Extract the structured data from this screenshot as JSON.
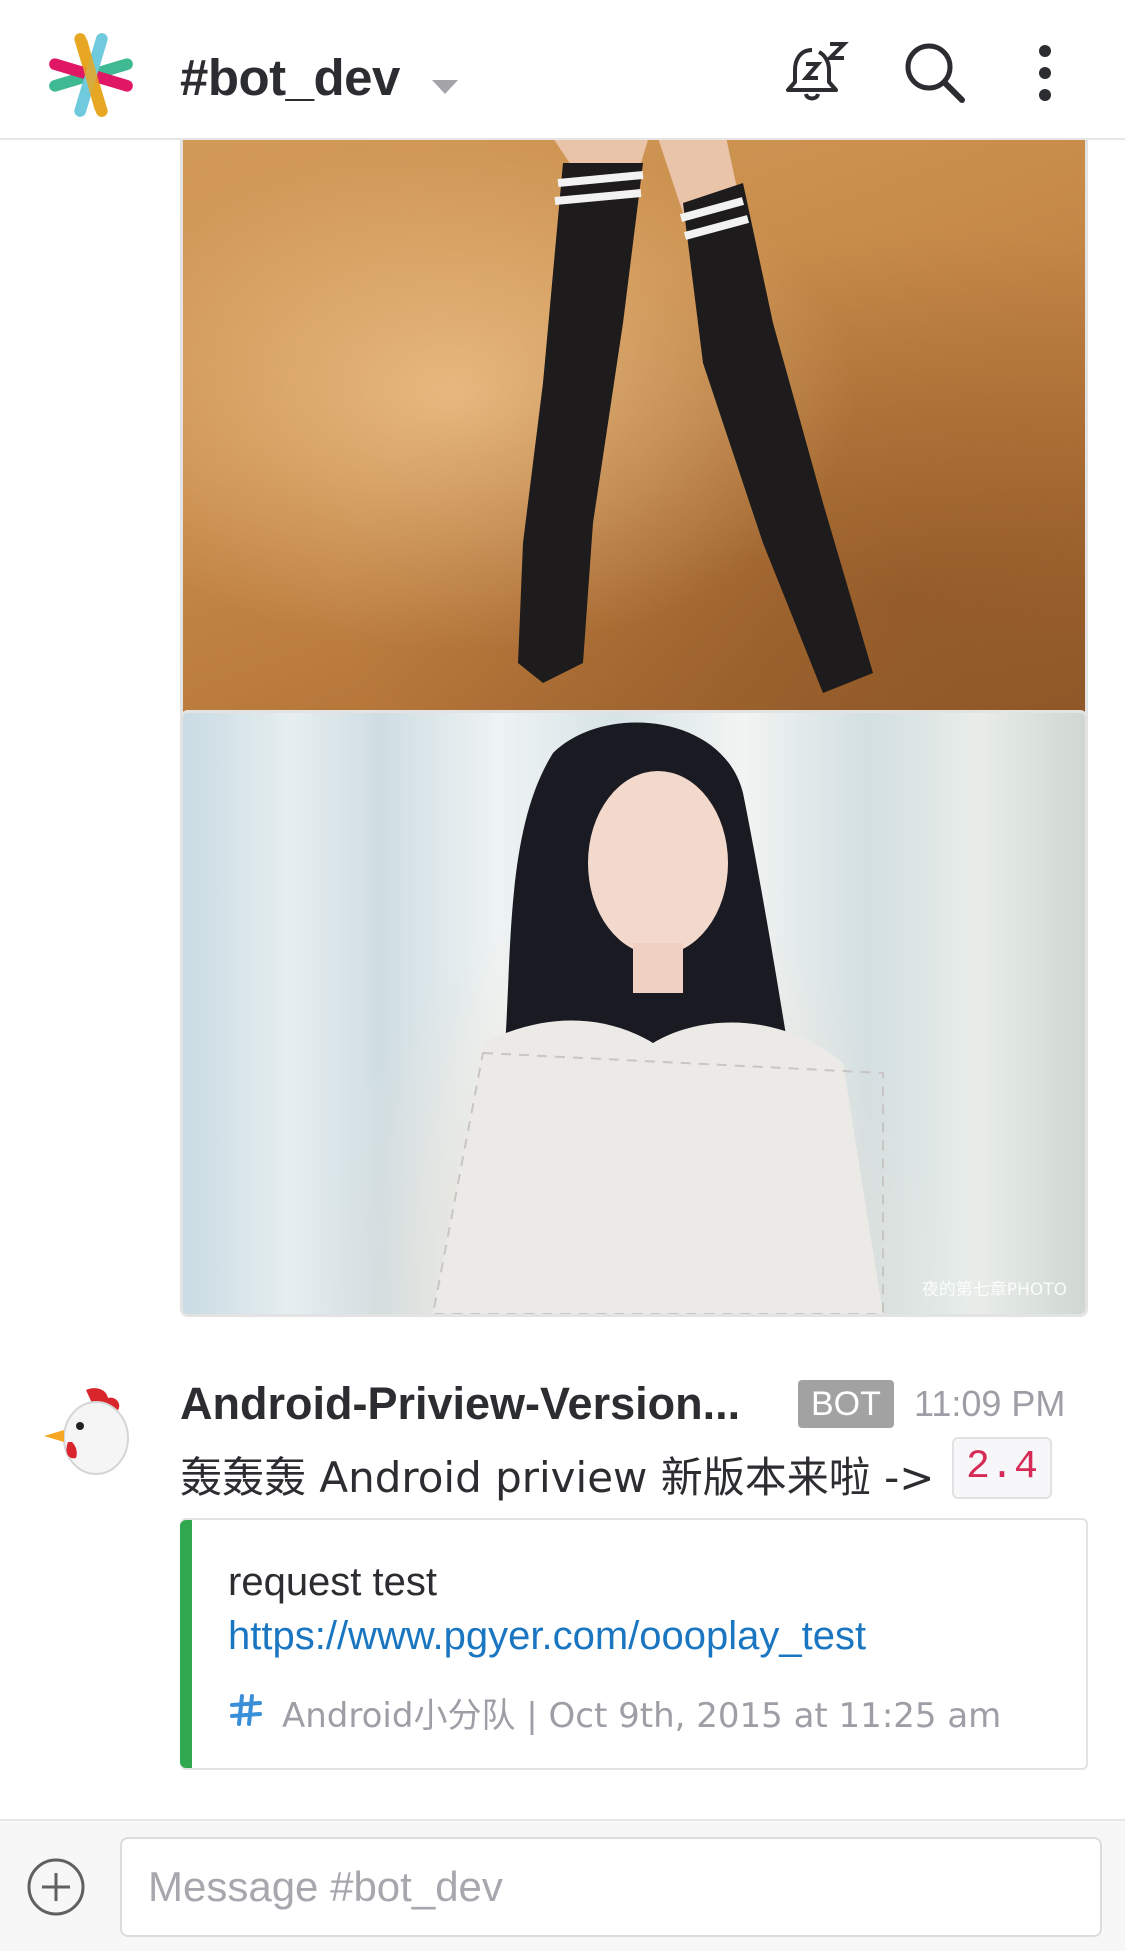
{
  "header": {
    "channel_name": "#bot_dev",
    "icons": [
      "slack-logo-icon",
      "chevron-down-icon",
      "do-not-disturb-bell-icon",
      "search-icon",
      "more-vertical-icon"
    ]
  },
  "feed": {
    "images": [
      {
        "watermark": ""
      },
      {
        "watermark": "夜的第七章PHOTO"
      }
    ],
    "message": {
      "sender": "Android-Priview-Version...",
      "badge": "BOT",
      "time": "11:09 PM",
      "text": "轰轰轰 Android priview 新版本来啦 ->",
      "version": "2.4",
      "attachment": {
        "title": "request test",
        "link": "https://www.pgyer.com/oooplay_test",
        "footer": "Android小分队 | Oct 9th, 2015 at 11:25 am",
        "accent_color": "#2fa84f"
      }
    }
  },
  "composer": {
    "placeholder": "Message #bot_dev"
  }
}
